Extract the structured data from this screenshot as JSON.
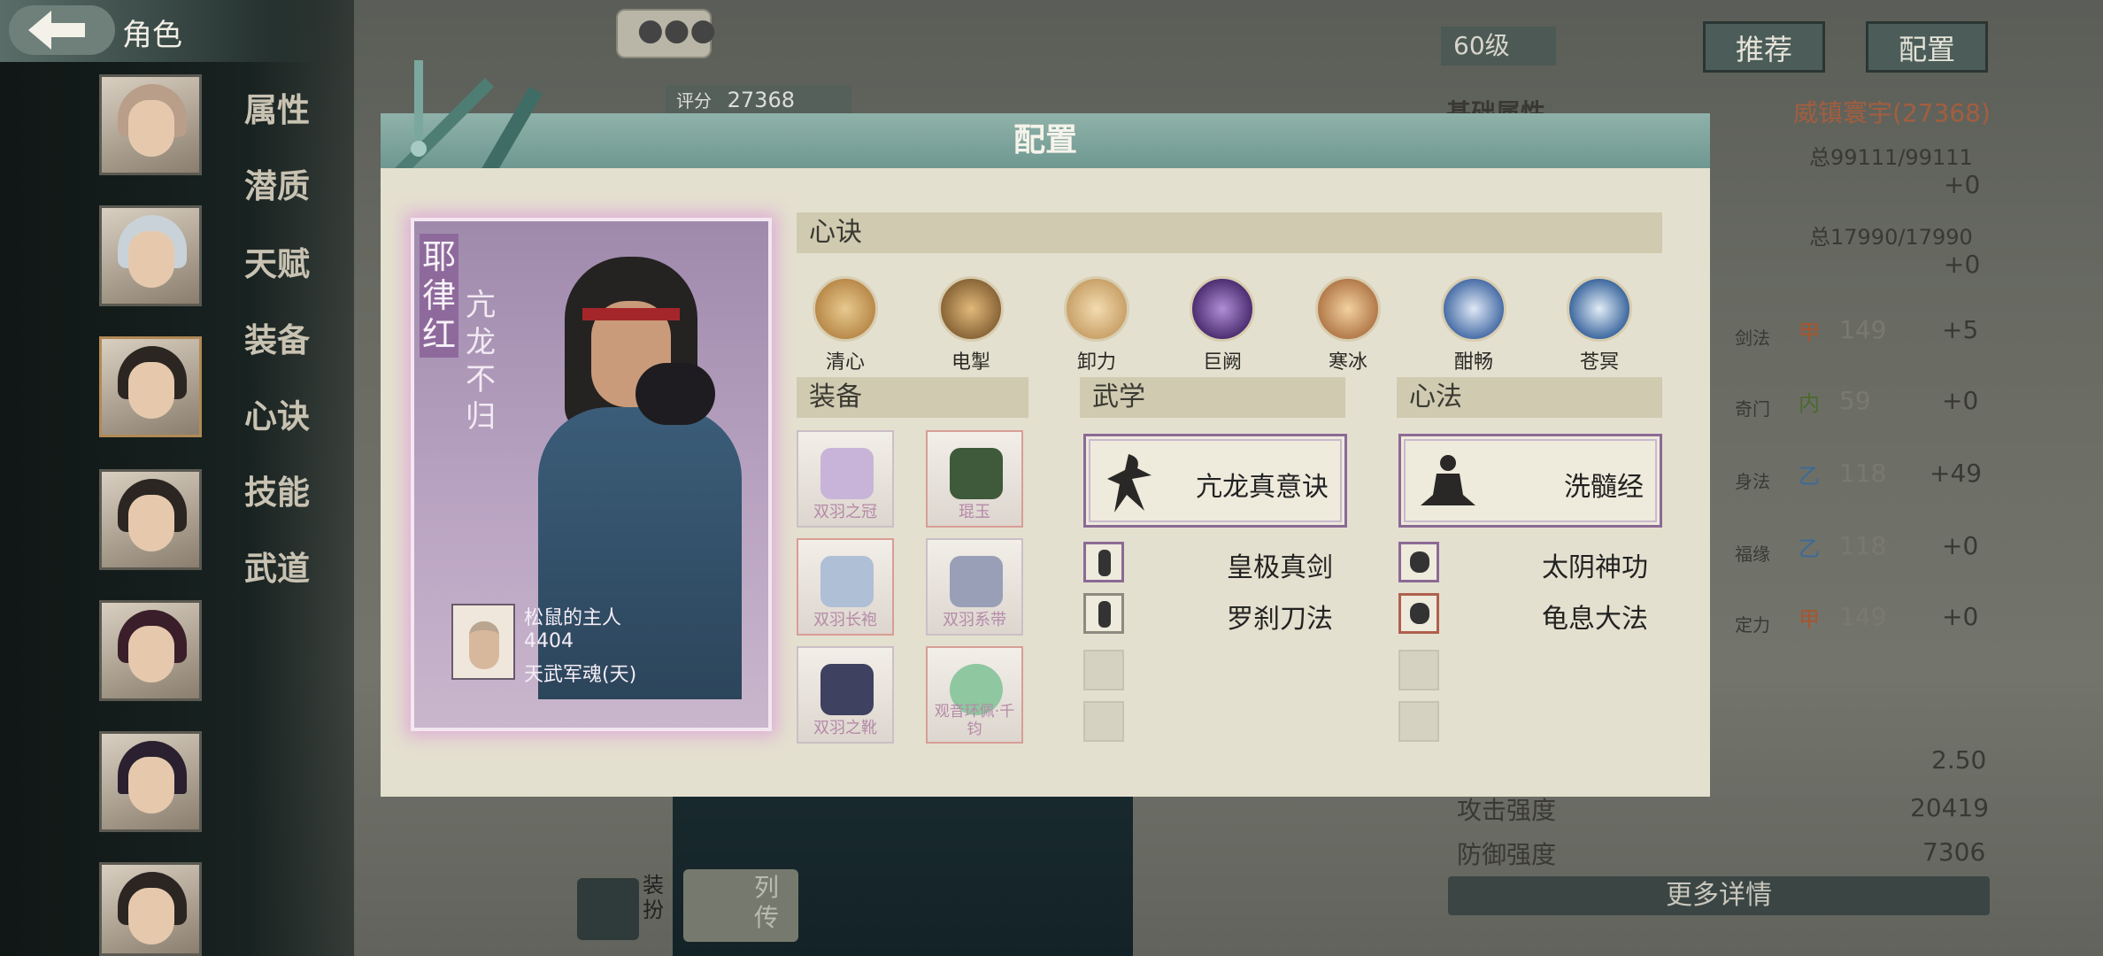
{
  "header": {
    "title": "角色",
    "level": "60级",
    "score_label": "评分",
    "score": "27368",
    "recommend_button": "推荐",
    "config_button": "配置"
  },
  "sidebar_tabs": [
    "属性",
    "潜质",
    "天赋",
    "装备",
    "心诀",
    "技能",
    "武道"
  ],
  "stats_panel": {
    "basic_title": "基础属性",
    "title_badge": "威镇寰宇(27368)",
    "hp": "总99111/99111",
    "hp_delta": "+0",
    "mp": "总17990/17990",
    "mp_delta": "+0",
    "attrs": [
      {
        "label": "剑法",
        "grade": "甲",
        "value": "149",
        "delta": "+5"
      },
      {
        "label": "奇门",
        "grade": "内",
        "value": "59",
        "delta": "+0"
      },
      {
        "label": "身法",
        "grade": "乙",
        "value": "118",
        "delta": "+49"
      },
      {
        "label": "福缘",
        "grade": "乙",
        "value": "118",
        "delta": "+0"
      },
      {
        "label": "定力",
        "grade": "甲",
        "value": "149",
        "delta": "+0"
      }
    ],
    "rows": [
      {
        "label": "",
        "value": "2.50"
      },
      {
        "label": "攻击强度",
        "value": "20419"
      },
      {
        "label": "防御强度",
        "value": "7306"
      }
    ],
    "more_button": "更多详情"
  },
  "bottom": {
    "outfit_label": "装扮",
    "biography_label": "列传"
  },
  "modal": {
    "title": "配置",
    "character": {
      "name": "耶律红",
      "title": "亢龙不归",
      "owner_label": "松鼠的主人",
      "owner_score": "4404",
      "owner_title": "天武军魂(天)"
    },
    "xinjue_title": "心诀",
    "xinjue": [
      {
        "name": "清心",
        "color": "#b98a4a"
      },
      {
        "name": "电掣",
        "color": "#8a6638"
      },
      {
        "name": "卸力",
        "color": "#caa26a"
      },
      {
        "name": "巨阙",
        "color": "#6b4a8e"
      },
      {
        "name": "寒冰",
        "color": "#b37a4a"
      },
      {
        "name": "酣畅",
        "color": "#4a6fa8"
      },
      {
        "name": "苍冥",
        "color": "#3f6aa0"
      }
    ],
    "equip_title": "装备",
    "equipment": [
      {
        "name": "双羽之冠",
        "color": "#c8b4d8",
        "border": "#cabfc6"
      },
      {
        "name": "琨玉",
        "color": "#3f5a3a",
        "border": "#d89d96"
      },
      {
        "name": "双羽长袍",
        "color": "#aebfd6",
        "border": "#d89d96"
      },
      {
        "name": "双羽系带",
        "color": "#9a9fb8",
        "border": "#cabfc6"
      },
      {
        "name": "双羽之靴",
        "color": "#3e4160",
        "border": "#cabfc6"
      },
      {
        "name": "观音环佩·千钧",
        "color": "#8fc7a0",
        "border": "#d89d96"
      }
    ],
    "wuxue_title": "武学",
    "wuxue_main": "亢龙真意诀",
    "wuxue_list": [
      "皇极真剑",
      "罗刹刀法"
    ],
    "xinfa_title": "心法",
    "xinfa_main": "洗髓经",
    "xinfa_list": [
      "太阴神功",
      "龟息大法"
    ]
  }
}
